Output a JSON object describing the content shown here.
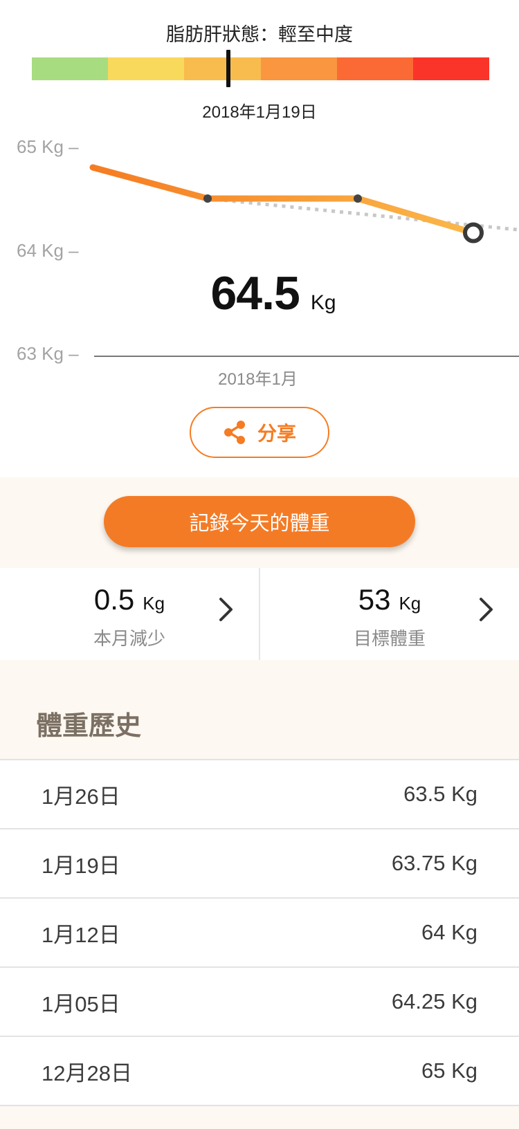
{
  "status": {
    "title": "脂肪肝狀態：輕至中度",
    "date": "2018年1月19日",
    "scale_colors": [
      "#a8dc80",
      "#f9d95c",
      "#f8bc4e",
      "#f9963f",
      "#fb6a34",
      "#fb3429"
    ],
    "marker_fraction": 0.43
  },
  "chart": {
    "y_labels": [
      "65 Kg –",
      "64 Kg –",
      "63 Kg –"
    ],
    "x_label": "2018年1月",
    "current_weight": "64.5",
    "current_unit": "Kg"
  },
  "chart_data": {
    "type": "line",
    "ylim": [
      63,
      65
    ],
    "yticks": [
      "65 Kg",
      "64 Kg",
      "63 Kg"
    ],
    "xlabel": "2018年1月",
    "series": [
      {
        "values": [
          64.82,
          64.52,
          64.52,
          64.19
        ]
      }
    ],
    "trend_dotted": true,
    "colors": {
      "line_start": "#f57c22",
      "line_end": "#fbb84a",
      "trend": "#c8c8c8"
    }
  },
  "share": {
    "label": "分享",
    "icon": "share-icon"
  },
  "record": {
    "label": "記錄今天的體重"
  },
  "stats": {
    "month_loss": {
      "value": "0.5",
      "unit": "Kg",
      "label": "本月減少"
    },
    "target": {
      "value": "53",
      "unit": "Kg",
      "label": "目標體重"
    }
  },
  "history": {
    "title": "體重歷史",
    "rows": [
      {
        "date": "1月26日",
        "weight": "63.5 Kg"
      },
      {
        "date": "1月19日",
        "weight": "63.75 Kg"
      },
      {
        "date": "1月12日",
        "weight": "64 Kg"
      },
      {
        "date": "1月05日",
        "weight": "64.25 Kg"
      },
      {
        "date": "12月28日",
        "weight": "65 Kg"
      }
    ]
  }
}
